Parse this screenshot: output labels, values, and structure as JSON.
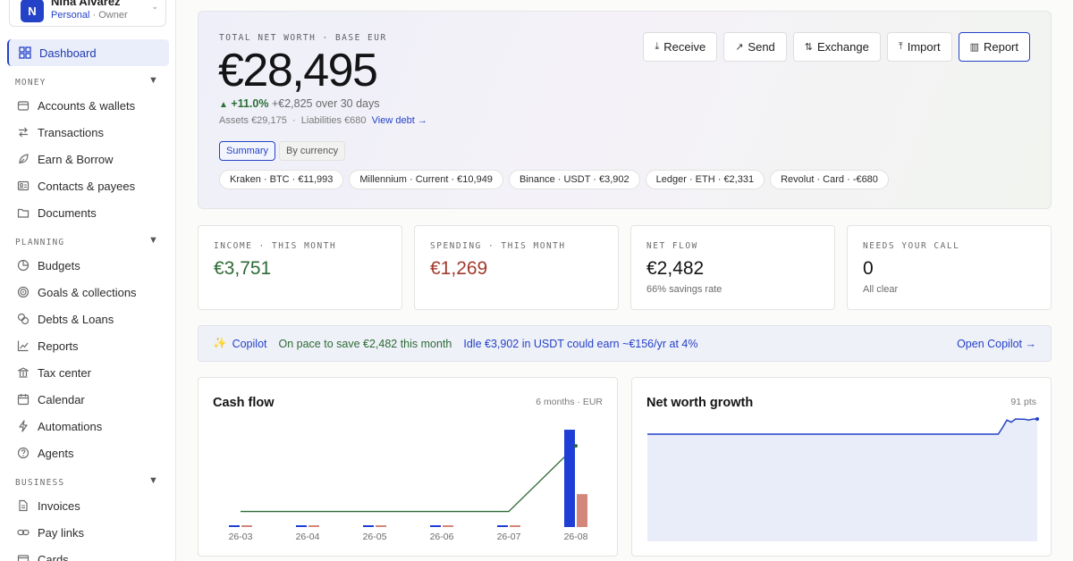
{
  "workspace": {
    "initial": "N",
    "name": "Nina Alvarez",
    "type": "Personal",
    "role": "Owner"
  },
  "sidebar": {
    "dashboard": "Dashboard",
    "sections": [
      {
        "label": "MONEY",
        "items": [
          "Accounts & wallets",
          "Transactions",
          "Earn & Borrow",
          "Contacts & payees",
          "Documents"
        ]
      },
      {
        "label": "PLANNING",
        "items": [
          "Budgets",
          "Goals & collections",
          "Debts & Loans",
          "Reports",
          "Tax center",
          "Calendar",
          "Automations",
          "Agents"
        ]
      },
      {
        "label": "BUSINESS",
        "items": [
          "Invoices",
          "Pay links",
          "Cards"
        ]
      }
    ]
  },
  "hero": {
    "label": "TOTAL NET WORTH · BASE EUR",
    "value": "€28,495",
    "change_pct": "+11.0%",
    "change_text": "+€2,825 over 30 days",
    "assets": "Assets €29,175",
    "sep": "·",
    "liabilities": "Liabilities €680",
    "view_debt": "View debt →",
    "seg_summary": "Summary",
    "seg_currency": "By currency",
    "chips": [
      "Kraken · BTC · €11,993",
      "Millennium · Current · €10,949",
      "Binance · USDT · €3,902",
      "Ledger · ETH · €2,331",
      "Revolut · Card · -€680"
    ]
  },
  "actions": [
    {
      "icon": "download-icon",
      "glyph": "⤓",
      "label": "Receive"
    },
    {
      "icon": "arrow-up-right-icon",
      "glyph": "↗",
      "label": "Send"
    },
    {
      "icon": "swap-icon",
      "glyph": "⇅",
      "label": "Exchange"
    },
    {
      "icon": "upload-icon",
      "glyph": "⤒",
      "label": "Import"
    },
    {
      "icon": "bar-chart-icon",
      "glyph": "▥",
      "label": "Report"
    }
  ],
  "kpis": [
    {
      "label": "INCOME · THIS MONTH",
      "value": "€3,751",
      "sub": "",
      "tone": "green"
    },
    {
      "label": "SPENDING · THIS MONTH",
      "value": "€1,269",
      "sub": "",
      "tone": "red"
    },
    {
      "label": "NET FLOW",
      "value": "€2,482",
      "sub": "66% savings rate",
      "tone": ""
    },
    {
      "label": "NEEDS YOUR CALL",
      "value": "0",
      "sub": "All clear",
      "tone": ""
    }
  ],
  "copilot": {
    "title": "Copilot",
    "pace": "On pace to save €2,482 this month",
    "idle": "Idle €3,902 in USDT could earn ~€156/yr at 4%",
    "open": "Open Copilot →"
  },
  "colors": {
    "accent": "#2442c8",
    "income": "#1f3ed6",
    "spending": "#d2877a",
    "net_line": "#2d6b36",
    "growth_line": "#2442c8",
    "growth_fill": "#e9edf9"
  },
  "chart_data": [
    {
      "type": "bar",
      "title": "Cash flow",
      "meta": "6 months · EUR",
      "categories": [
        "26-03",
        "26-04",
        "26-05",
        "26-06",
        "26-07",
        "26-08"
      ],
      "series": [
        {
          "values": [
            0,
            0,
            0,
            0,
            0,
            3751
          ]
        },
        {
          "values": [
            0,
            0,
            0,
            0,
            0,
            1269
          ]
        }
      ],
      "overlay_line": {
        "values": [
          0,
          0,
          0,
          0,
          0,
          2482
        ]
      },
      "ylim": [
        -2500,
        3751
      ]
    },
    {
      "type": "area",
      "title": "Net worth growth",
      "meta": "91 pts",
      "points": 91,
      "x_start": 0,
      "x_end": 90,
      "values": [
        25670,
        25670,
        25670,
        25670,
        25670,
        25670,
        25670,
        25670,
        25670,
        25670,
        25670,
        25670,
        25670,
        25670,
        25670,
        25670,
        25670,
        25670,
        25670,
        25670,
        25670,
        25670,
        25670,
        25670,
        25670,
        25670,
        25670,
        25670,
        25670,
        25670,
        25670,
        25670,
        25670,
        25670,
        25670,
        25670,
        25670,
        25670,
        25670,
        25670,
        25670,
        25670,
        25670,
        25670,
        25670,
        25670,
        25670,
        25670,
        25670,
        25670,
        25670,
        25670,
        25670,
        25670,
        25670,
        25670,
        25670,
        25670,
        25670,
        25670,
        25670,
        25670,
        25670,
        25670,
        25670,
        25670,
        25670,
        25670,
        25670,
        25670,
        25670,
        25670,
        25670,
        25670,
        25670,
        25670,
        25670,
        25670,
        25670,
        25670,
        25670,
        25670,
        26900,
        28300,
        27900,
        28500,
        28450,
        28470,
        28300,
        28480,
        28495
      ],
      "ylim": [
        0,
        30000
      ]
    }
  ]
}
